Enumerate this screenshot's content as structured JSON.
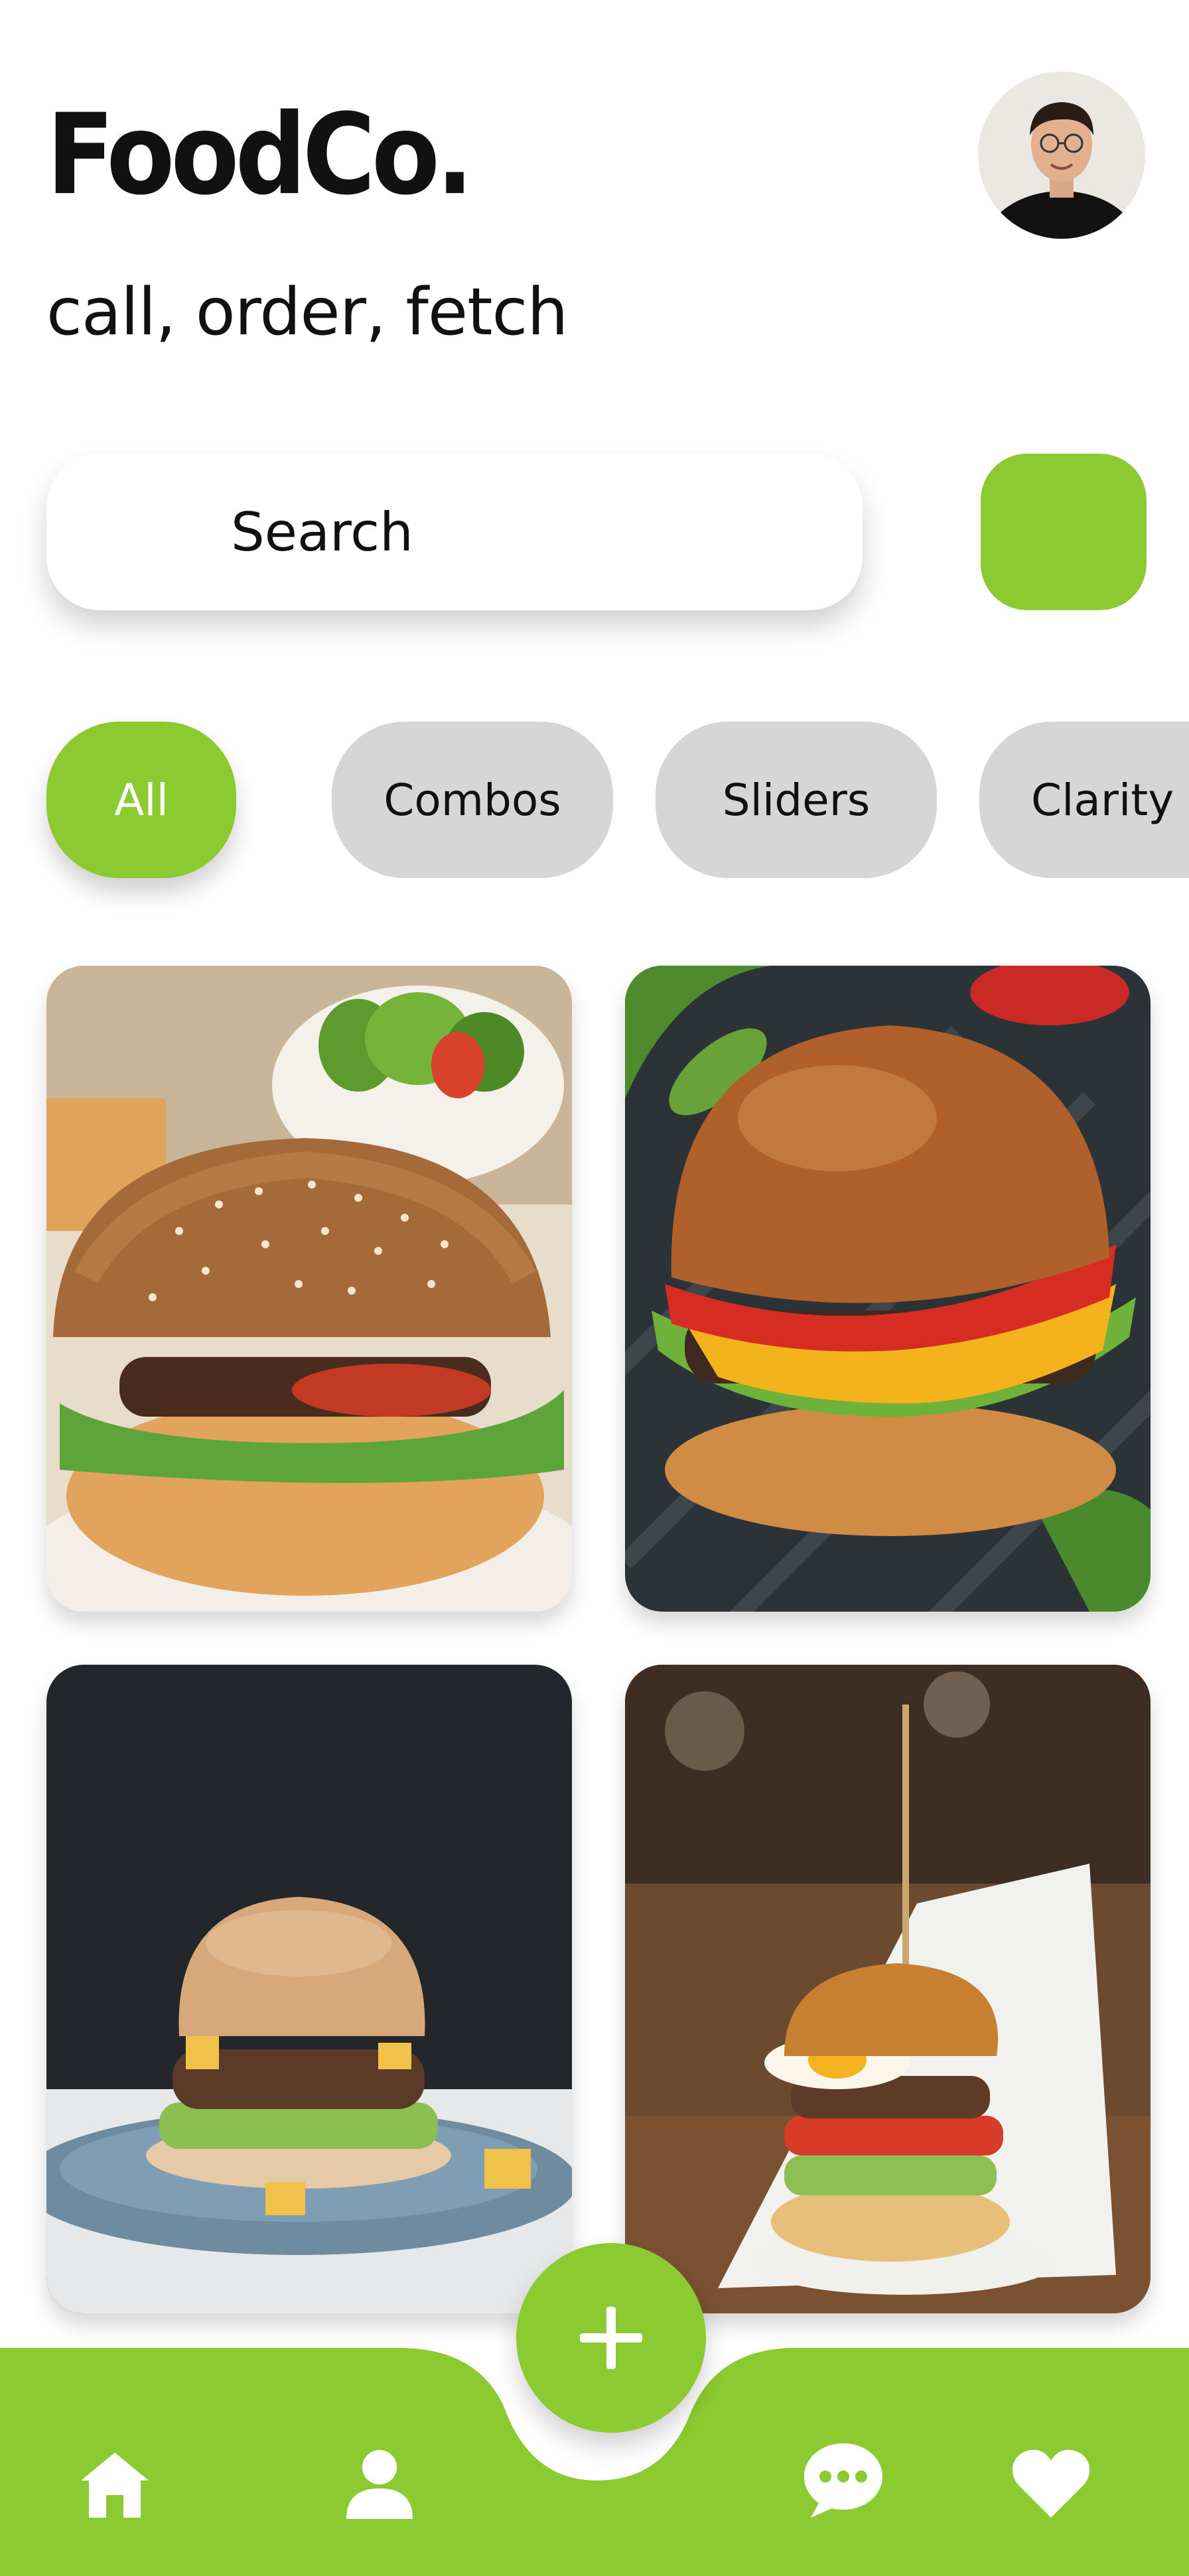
{
  "app": {
    "logo_text": "FoodCo.",
    "tagline": "call, order, fetch"
  },
  "search": {
    "label": "Search"
  },
  "categories": [
    {
      "label": "All",
      "active": true
    },
    {
      "label": "Combos",
      "active": false
    },
    {
      "label": "Sliders",
      "active": false
    },
    {
      "label": "Clarity",
      "active": false
    }
  ],
  "products": [
    {
      "image": "sesame-burger-with-salad-photo"
    },
    {
      "image": "cheese-burger-on-slate-photo"
    },
    {
      "image": "veggie-burger-on-blue-plate-photo"
    },
    {
      "image": "egg-burger-with-skewer-photo"
    }
  ],
  "nav": {
    "items": [
      "home-icon",
      "profile-icon",
      "add-icon",
      "chat-icon",
      "heart-icon"
    ]
  },
  "colors": {
    "accent": "#8cca31",
    "chip_inactive": "#d6d6d6",
    "text": "#111111"
  }
}
